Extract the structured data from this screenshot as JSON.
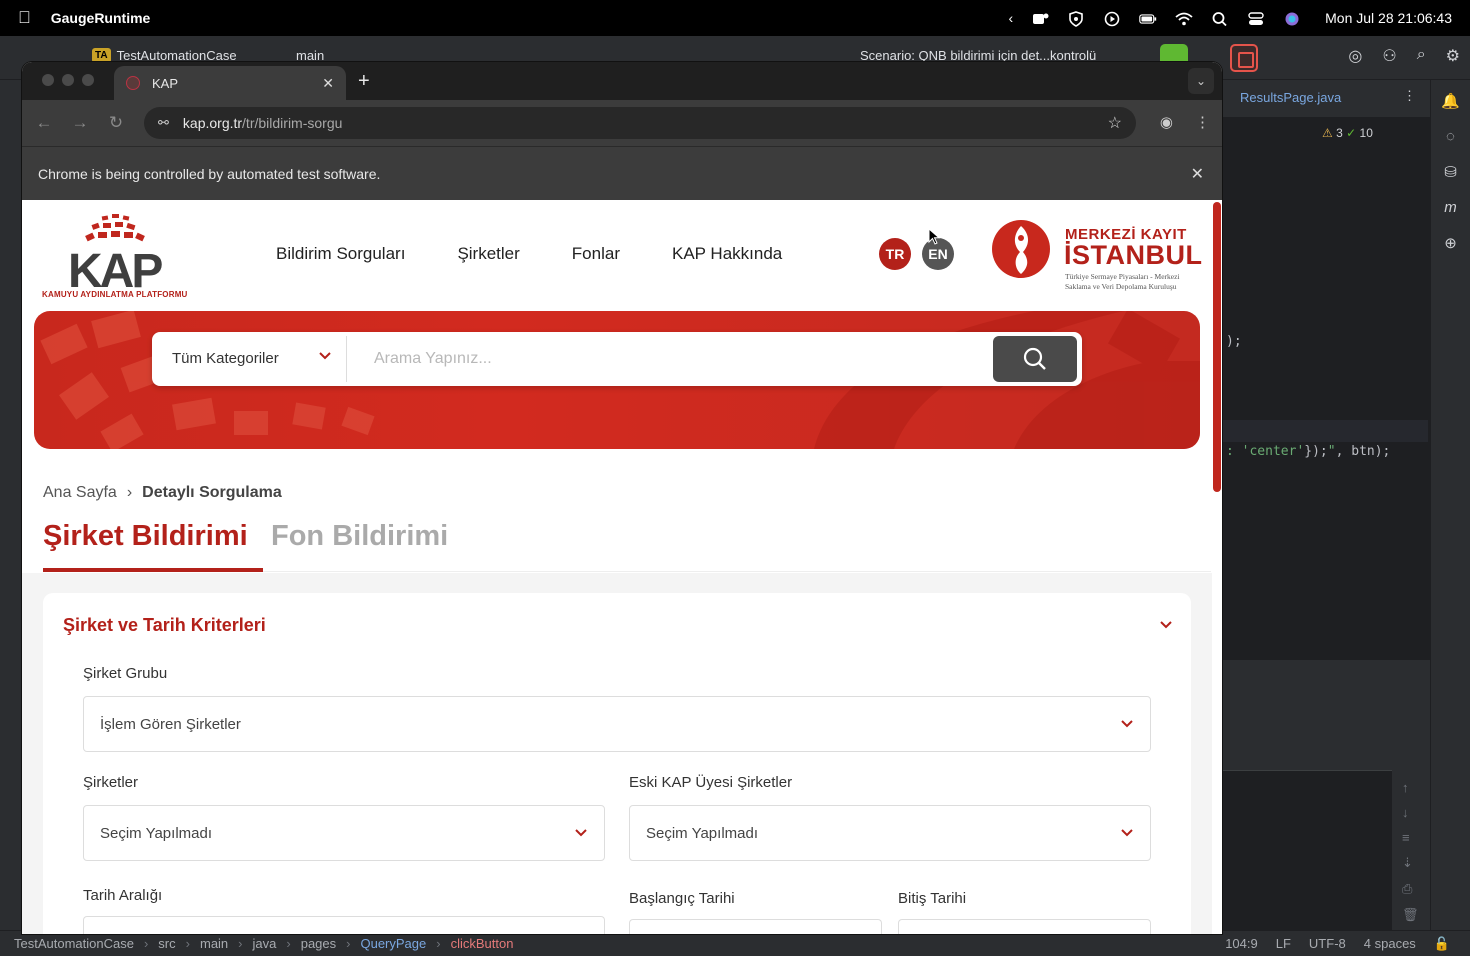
{
  "menubar": {
    "app_name": "GaugeRuntime",
    "clock": "Mon Jul 28  21:06:43"
  },
  "ide": {
    "project": "TestAutomationCase",
    "project_badge": "TA",
    "branch": "main",
    "scenario": "Scenario: QNB bildirimi için det...kontrolü",
    "editor_tab": "ResultsPage.java",
    "warnings": "3",
    "checks": "10",
    "code_line_1": ");",
    "code_line_2_pre": ": ",
    "code_line_2_str": "'center'",
    "code_line_2_mid": "});",
    "code_line_2_str2": "\"",
    "code_line_2_post": ", btn);",
    "status": {
      "crumbs": [
        "TestAutomationCase",
        "src",
        "main",
        "java",
        "pages",
        "QueryPage",
        "clickButton"
      ],
      "position": "104:9",
      "line_sep": "LF",
      "encoding": "UTF-8",
      "indent": "4 spaces"
    }
  },
  "browser": {
    "tab_title": "KAP",
    "url_host": "kap.org.tr",
    "url_path": "/tr/bildirim-sorgu",
    "infobar_text": "Chrome is being controlled by automated test software."
  },
  "site": {
    "logo_word": "KAP",
    "logo_sub": "KAMUYU AYDINLATMA PLATFORMU",
    "nav": [
      "Bildirim Sorguları",
      "Şirketler",
      "Fonlar",
      "KAP Hakkında"
    ],
    "lang_tr": "TR",
    "lang_en": "EN",
    "mki_line1": "MERKEZİ KAYIT",
    "mki_line2": "İSTANBUL",
    "mki_line3": "Türkiye Sermaye Piyasaları - Merkezi Saklama ve Veri Depolama Kuruluşu",
    "search": {
      "category": "Tüm Kategoriler",
      "placeholder": "Arama Yapınız..."
    },
    "breadcrumb": {
      "home": "Ana Sayfa",
      "sep": "›",
      "current": "Detaylı Sorgulama"
    },
    "tabs": {
      "company": "Şirket Bildirimi",
      "fund": "Fon Bildirimi"
    },
    "filters": {
      "title": "Şirket ve Tarih Kriterleri",
      "group_label": "Şirket Grubu",
      "group_value": "İşlem Gören Şirketler",
      "companies_label": "Şirketler",
      "companies_value": "Seçim Yapılmadı",
      "old_label": "Eski KAP Üyesi Şirketler",
      "old_value": "Seçim Yapılmadı",
      "date_range_label": "Tarih Aralığı",
      "start_label": "Başlangıç Tarihi",
      "end_label": "Bitiş Tarihi"
    }
  },
  "colors": {
    "brand_red": "#b3211a",
    "hero_red": "#c8281d",
    "search_button": "#4a4a4a"
  }
}
